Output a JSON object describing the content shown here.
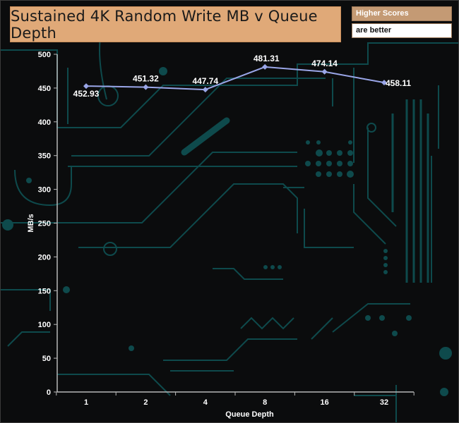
{
  "chart_data": {
    "type": "line",
    "title": "Sustained 4K Random Write MB v Queue Depth",
    "xlabel": "Queue Depth",
    "ylabel": "MB/s",
    "categories": [
      "1",
      "2",
      "4",
      "8",
      "16",
      "32"
    ],
    "series": [
      {
        "values": [
          452.93,
          451.32,
          447.74,
          481.31,
          474.14,
          458.11
        ],
        "color": "#9aa6e8"
      }
    ],
    "data_labels": [
      "452.93",
      "451.32",
      "447.74",
      "481.31",
      "474.14",
      "458.11"
    ],
    "ylim": [
      0,
      500
    ],
    "yticks": [
      "0",
      "50",
      "100",
      "150",
      "200",
      "250",
      "300",
      "350",
      "400",
      "450",
      "500"
    ],
    "grid": false,
    "legend": "none"
  },
  "badges": {
    "line1": "Higher Scores",
    "line2": "are better"
  },
  "colors": {
    "background": "#0b0c0d",
    "circuit": "#0e4a4c",
    "title_bg": "#e0a978",
    "axis": "#b8b8b8"
  }
}
